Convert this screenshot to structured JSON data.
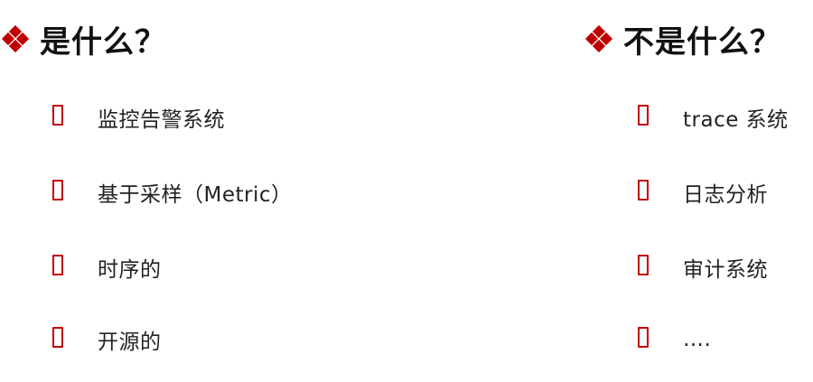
{
  "accent_color": "#c00000",
  "left": {
    "heading": "是什么？",
    "items": [
      {
        "label": "监控告警系统"
      },
      {
        "label": "基于采样（Metric）"
      },
      {
        "label": "时序的"
      },
      {
        "label": "开源的"
      }
    ]
  },
  "right": {
    "heading": "不是什么？",
    "items": [
      {
        "label": "trace 系统"
      },
      {
        "label": "日志分析"
      },
      {
        "label": "审计系统"
      },
      {
        "label": "…."
      }
    ]
  },
  "icons": {
    "heading_bullet": "diamond-cluster-icon",
    "item_bullet": "hollow-box-icon"
  }
}
